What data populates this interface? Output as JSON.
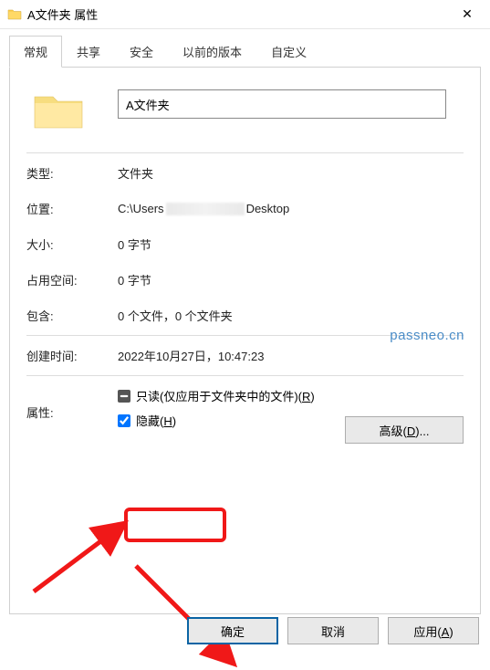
{
  "window": {
    "title": "A文件夹 属性",
    "close": "✕"
  },
  "tabs": [
    {
      "label": "常规",
      "active": true
    },
    {
      "label": "共享",
      "active": false
    },
    {
      "label": "安全",
      "active": false
    },
    {
      "label": "以前的版本",
      "active": false
    },
    {
      "label": "自定义",
      "active": false
    }
  ],
  "fields": {
    "folder_name": "A文件夹",
    "type_label": "类型:",
    "type_value": "文件夹",
    "location_label": "位置:",
    "location_prefix": "C:\\Users",
    "location_suffix": "Desktop",
    "size_label": "大小:",
    "size_value": "0 字节",
    "sizeondisk_label": "占用空间:",
    "sizeondisk_value": "0 字节",
    "contains_label": "包含:",
    "contains_value": "0 个文件，0 个文件夹",
    "created_label": "创建时间:",
    "created_value": "2022年10月27日，10:47:23",
    "attr_label": "属性:",
    "readonly_label_pre": "只读(仅应用于文件夹中的文件)(",
    "readonly_key": "R",
    "readonly_label_post": ")",
    "hidden_label_pre": "隐藏(",
    "hidden_key": "H",
    "hidden_label_post": ")",
    "advanced_pre": "高级(",
    "advanced_key": "D",
    "advanced_post": ")..."
  },
  "watermark": "passneo.cn",
  "footer": {
    "ok": "确定",
    "cancel": "取消",
    "apply_pre": "应用(",
    "apply_key": "A",
    "apply_post": ")"
  }
}
